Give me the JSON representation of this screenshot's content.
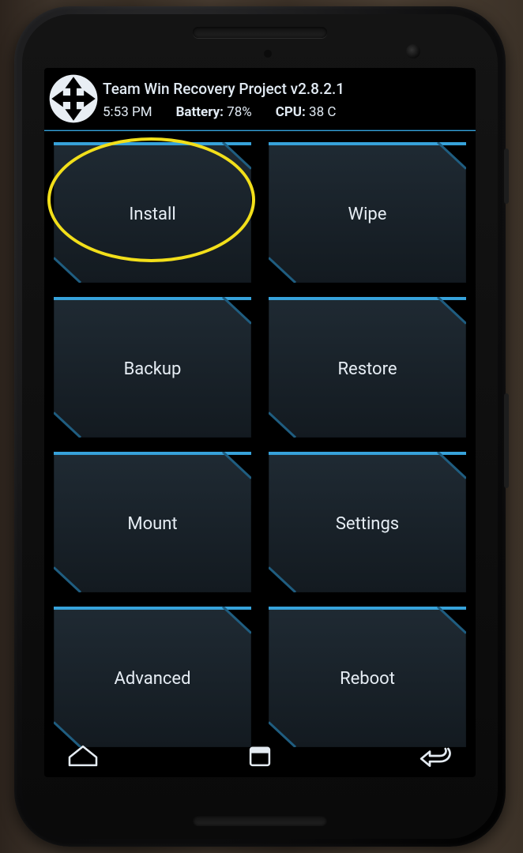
{
  "header": {
    "title": "Team Win Recovery Project  v2.8.2.1",
    "time": "5:53 PM",
    "battery_label": "Battery:",
    "battery_value": "78%",
    "cpu_label": "CPU:",
    "cpu_value": "38 C"
  },
  "menu": {
    "items": [
      {
        "id": "install",
        "label": "Install"
      },
      {
        "id": "wipe",
        "label": "Wipe"
      },
      {
        "id": "backup",
        "label": "Backup"
      },
      {
        "id": "restore",
        "label": "Restore"
      },
      {
        "id": "mount",
        "label": "Mount"
      },
      {
        "id": "settings",
        "label": "Settings"
      },
      {
        "id": "advanced",
        "label": "Advanced"
      },
      {
        "id": "reboot",
        "label": "Reboot"
      }
    ]
  },
  "nav": {
    "home": "home-icon",
    "files": "files-icon",
    "back": "back-icon"
  },
  "colors": {
    "accent": "#37a3db",
    "accent_dark": "#1f5d80",
    "tile_fill_top": "#1f2a33",
    "tile_fill_bot": "#131a20",
    "highlight": "#f2df1a"
  },
  "annotation": {
    "highlighted_item": "install"
  }
}
